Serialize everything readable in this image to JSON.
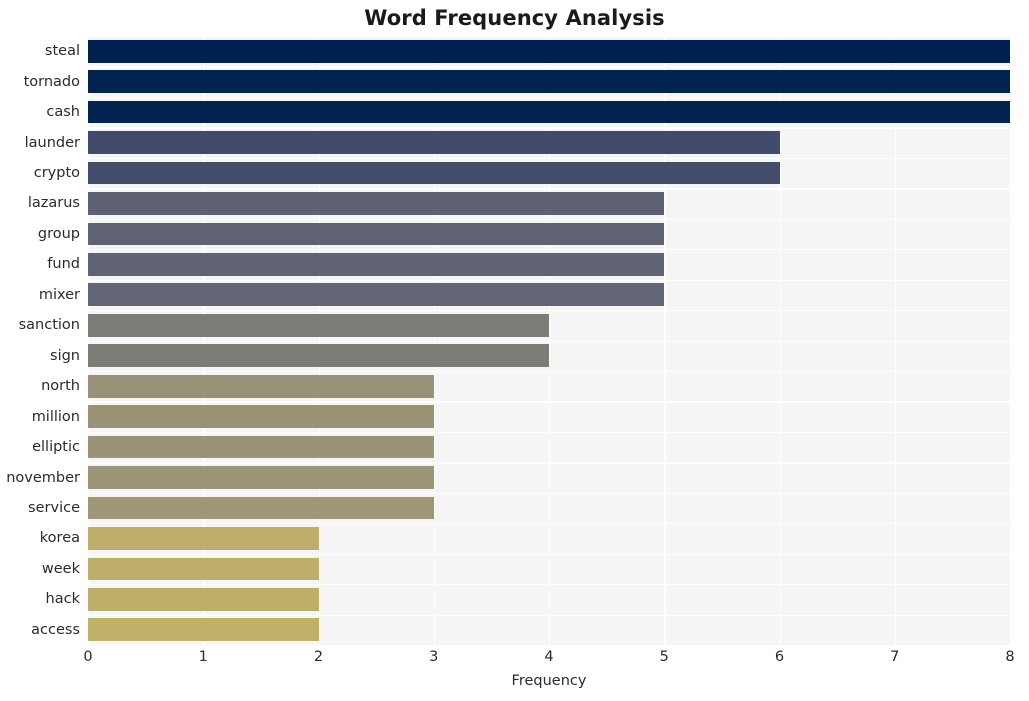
{
  "chart_data": {
    "type": "bar",
    "orientation": "horizontal",
    "title": "Word Frequency Analysis",
    "xlabel": "Frequency",
    "ylabel": "",
    "xlim": [
      0,
      8
    ],
    "xticks": [
      "0",
      "1",
      "2",
      "3",
      "4",
      "5",
      "6",
      "7",
      "8"
    ],
    "grid": true,
    "legend": null,
    "categories": [
      "steal",
      "tornado",
      "cash",
      "launder",
      "crypto",
      "lazarus",
      "group",
      "fund",
      "mixer",
      "sanction",
      "sign",
      "north",
      "million",
      "elliptic",
      "november",
      "service",
      "korea",
      "week",
      "hack",
      "access"
    ],
    "values": [
      8,
      8,
      8,
      6,
      6,
      5,
      5,
      5,
      5,
      4,
      4,
      3,
      3,
      3,
      3,
      3,
      2,
      2,
      2,
      2
    ],
    "colors": [
      "#002051",
      "#00234f",
      "#00234f",
      "#414a6b",
      "#454d6d",
      "#5d6171",
      "#5f6372",
      "#606472",
      "#626674",
      "#7c7b77",
      "#7d7c77",
      "#989077",
      "#9a9277",
      "#9b9377",
      "#9d9577",
      "#9e9677",
      "#bdae6a",
      "#bdae69",
      "#bdaf68",
      "#bfb167"
    ]
  },
  "style": {
    "figure_background": "#ffffff",
    "axes_background": "#f5f5f6",
    "grid_color": "#ffffff",
    "text_color": "#2b2b2b",
    "title_color": "#1a1a1a"
  }
}
